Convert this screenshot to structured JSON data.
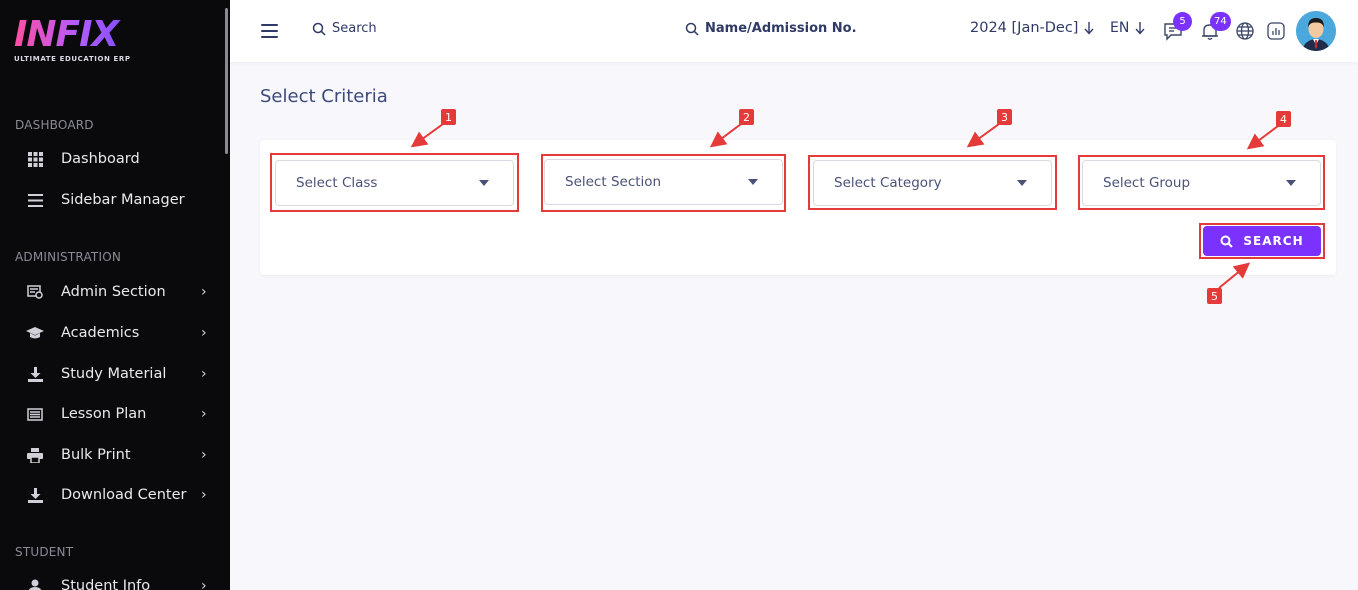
{
  "brand": {
    "name": "INFIX",
    "tagline": "ULTIMATE EDUCATION ERP"
  },
  "sidebar": {
    "sections": [
      {
        "title": "DASHBOARD"
      },
      {
        "title": "ADMINISTRATION"
      },
      {
        "title": "STUDENT"
      }
    ],
    "items": [
      {
        "label": "Dashboard",
        "icon": "grid-icon"
      },
      {
        "label": "Sidebar Manager",
        "icon": "menu-lines-icon"
      },
      {
        "label": "Admin Section",
        "icon": "admin-icon"
      },
      {
        "label": "Academics",
        "icon": "graduation-cap-icon"
      },
      {
        "label": "Study Material",
        "icon": "download-icon"
      },
      {
        "label": "Lesson Plan",
        "icon": "lesson-plan-icon"
      },
      {
        "label": "Bulk Print",
        "icon": "printer-icon"
      },
      {
        "label": "Download Center",
        "icon": "download-icon"
      },
      {
        "label": "Student Info",
        "icon": "user-icon"
      }
    ]
  },
  "topbar": {
    "search_label": "Search",
    "name_search_label": "Name/Admission No.",
    "year": "2024 [Jan-Dec]",
    "language": "EN",
    "messages_count": "5",
    "notifications_count": "74"
  },
  "main": {
    "title": "Select Criteria",
    "selects": [
      {
        "placeholder": "Select Class",
        "marker": "1"
      },
      {
        "placeholder": "Select Section",
        "marker": "2"
      },
      {
        "placeholder": "Select Category",
        "marker": "3"
      },
      {
        "placeholder": "Select Group",
        "marker": "4"
      }
    ],
    "search_button": "SEARCH",
    "search_marker": "5"
  },
  "colors": {
    "accent": "#7c32ff",
    "annotation": "#e53a3a",
    "sidebar_bg": "#0a0a0d"
  }
}
